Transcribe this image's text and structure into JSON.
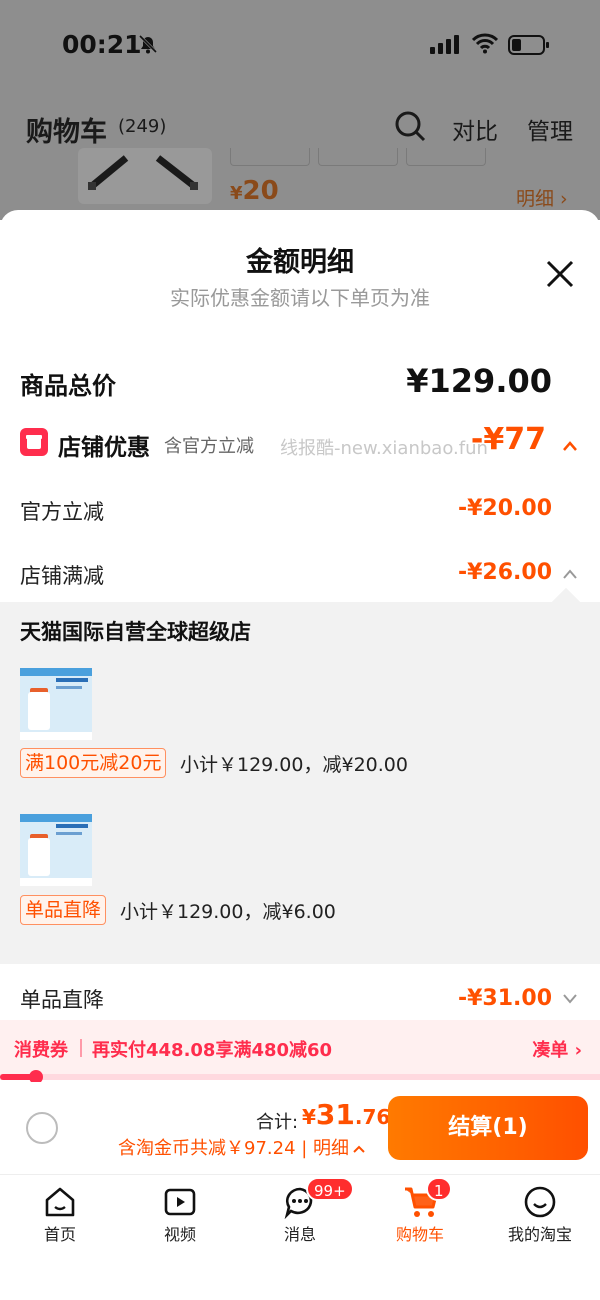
{
  "status_bar": {
    "time": "00:21"
  },
  "background_page": {
    "title": "购物车",
    "count": "(249)",
    "compare": "对比",
    "manage": "管理",
    "item_price_symbol": "¥",
    "item_price": "20",
    "item_detail": "明细 ›"
  },
  "sheet": {
    "title": "金额明细",
    "subtitle": "实际优惠金额请以下单页为准",
    "total_label": "商品总价",
    "total_amount": "¥129.00",
    "shop_discount_label": "店铺优惠",
    "shop_discount_sub": "含官方立减",
    "watermark": "线报酷-new.xianbao.fun",
    "shop_discount_amount": "-¥77",
    "official_label": "官方立减",
    "official_amount": "-¥20.00",
    "full_reduction_label": "店铺满减",
    "full_reduction_amount": "-¥26.00",
    "store_name": "天猫国际自营全球超级店",
    "items": [
      {
        "promo": "满100元减20元",
        "subtotal": "小计￥129.00，减¥20.00"
      },
      {
        "promo": "单品直降",
        "subtotal": "小计￥129.00，减¥6.00"
      }
    ],
    "single_drop_label": "单品直降",
    "single_drop_amount": "-¥31.00"
  },
  "coupon": {
    "label": "消费券",
    "text": "再实付448.08享满480减60",
    "action": "凑单 ›",
    "progress": 0.06
  },
  "checkout": {
    "sum_label": "合计:",
    "sum_symbol": "¥",
    "sum_int": "31",
    "sum_dec": ".76",
    "savings": "含淘金币共减￥97.24 | 明细",
    "pay_label": "结算(1)"
  },
  "tabs": [
    {
      "label": "首页",
      "icon": "home-icon"
    },
    {
      "label": "视频",
      "icon": "video-icon"
    },
    {
      "label": "消息",
      "icon": "message-icon",
      "badge": "99+"
    },
    {
      "label": "购物车",
      "icon": "cart-icon",
      "badge": "1",
      "active": true
    },
    {
      "label": "我的淘宝",
      "icon": "profile-icon"
    }
  ],
  "colors": {
    "accent": "#ff5000",
    "coupon": "#ff2d4d"
  }
}
